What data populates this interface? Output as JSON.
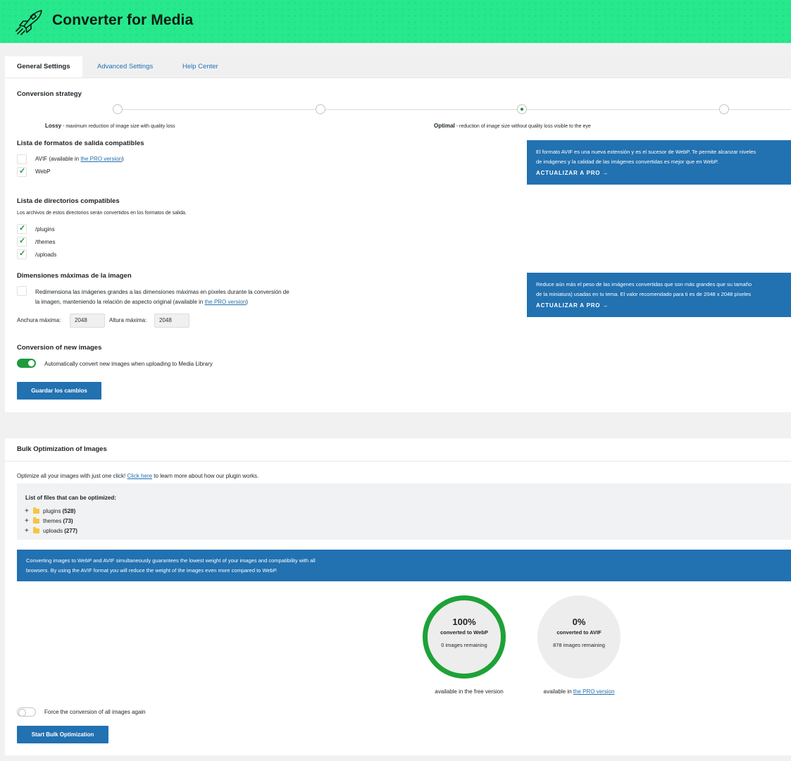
{
  "header": {
    "title": "Converter for Media",
    "logo_icon": "rocket-icon",
    "bg_color": "#27e88d"
  },
  "tabs": [
    {
      "label": "General Settings",
      "active": true
    },
    {
      "label": "Advanced Settings",
      "active": false
    },
    {
      "label": "Help Center",
      "active": false
    }
  ],
  "strategy": {
    "title": "Conversion strategy",
    "lossy_label": "Lossy",
    "lossy_desc": "- maximum reduction of image size with quality loss",
    "optimal_label": "Optimal",
    "optimal_desc": "- reduction of image size without quality loss visible to the eye",
    "selected": "Optimal"
  },
  "formats": {
    "title": "Lista de formatos de salida compatibles",
    "avif_label": "AVIF (available in ",
    "avif_link": "the PRO version",
    "avif_close": ")",
    "avif_checked": false,
    "webp_label": "WebP",
    "webp_checked": true,
    "info": {
      "line1": "El formato AVIF es una nueva extensión y es el sucesor de WebP. Te permite alcanzar niveles",
      "line2": "de imágenes y la calidad de las imágenes convertidas es mejor que en WebP.",
      "cta": "ACTUALIZAR A PRO →"
    }
  },
  "directories": {
    "title": "Lista de directorios compatibles",
    "desc": "Los archivos de estos directorios serán convertidos en los formatos de salida.",
    "items": [
      {
        "label": "/plugins",
        "checked": true
      },
      {
        "label": "/themes",
        "checked": true
      },
      {
        "label": "/uploads",
        "checked": true
      }
    ]
  },
  "dimensions": {
    "title": "Dimensiones máximas de la imagen",
    "resize_line1": "Redimensiona las imágenes grandes a las dimensiones máximas en píxeles durante la conversión de",
    "resize_line2": "la imagen, manteniendo la relación de aspecto original (available in ",
    "resize_link": "the PRO version",
    "resize_close": ")",
    "width_label": "Anchura máxima:",
    "width_value": "2048",
    "height_label": "Altura máxima:",
    "height_value": "2048",
    "info": {
      "line1": "Reduce aún más el peso de las imágenes convertidas que son más grandes que su tamaño",
      "line2": "de la miniatura) usadas en tu tema. El valor recomendado para ti es de 2048 x 2048 píxeles",
      "cta": "ACTUALIZAR A PRO →"
    }
  },
  "new_images": {
    "title": "Conversion of new images",
    "toggle_label": "Automatically convert new images when uploading to Media Library",
    "enabled": true
  },
  "save_button": "Guardar los cambios",
  "bulk": {
    "title": "Bulk Optimization of Images",
    "intro_before": "Optimize all your images with just one click! ",
    "intro_link": "Click here",
    "intro_after": " to learn more about how our plugin works.",
    "list_title": "List of files that can be optimized:",
    "tree": [
      {
        "name": "plugins",
        "count": "(528)"
      },
      {
        "name": "themes",
        "count": "(73)"
      },
      {
        "name": "uploads",
        "count": "(277)"
      }
    ],
    "banner_line1": "Converting images to WebP and AVIF simultaneously guarantees the lowest weight of your images and compatibility with all",
    "banner_line2": "browsers. By using the AVIF format you will reduce the weight of the images even more compared to WebP.",
    "webp": {
      "percent": "100%",
      "label": "converted to WebP",
      "remaining": "0 images remaining",
      "caption": "available in the free version",
      "progress": 1.0
    },
    "avif": {
      "percent": "0%",
      "label": "converted to AVIF",
      "remaining": "878 images remaining",
      "caption_before": "available in ",
      "caption_link": "the PRO version",
      "progress": 0.0
    },
    "force_label": "Force the conversion of all images again",
    "force_enabled": false,
    "start_button": "Start Bulk Optimization"
  }
}
